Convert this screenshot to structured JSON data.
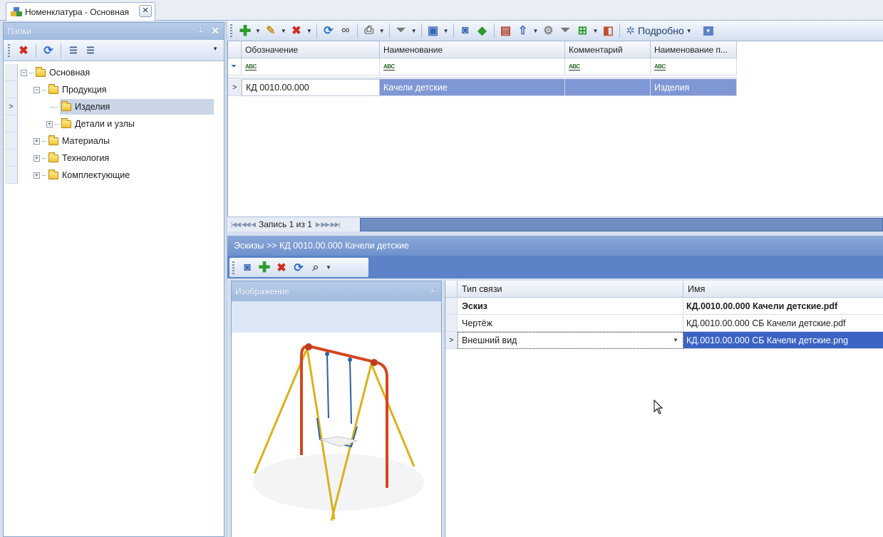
{
  "tab": {
    "title": "Номенклатура - Основная",
    "close": "✕"
  },
  "folders_panel": {
    "title": "Папки",
    "tree": [
      {
        "label": "Основная",
        "level": 0,
        "expander": "−"
      },
      {
        "label": "Продукция",
        "level": 1,
        "expander": "−"
      },
      {
        "label": "Изделия",
        "level": 2,
        "expander": "",
        "selected": true
      },
      {
        "label": "Детали и узлы",
        "level": 2,
        "expander": "+"
      },
      {
        "label": "Материалы",
        "level": 1,
        "expander": "+"
      },
      {
        "label": "Технология",
        "level": 1,
        "expander": "+"
      },
      {
        "label": "Комплектующие",
        "level": 1,
        "expander": "+"
      }
    ]
  },
  "main_toolbar": {
    "detail_label": "Подробно"
  },
  "top_grid": {
    "columns": [
      "Обозначение",
      "Наименование",
      "Комментарий",
      "Наименование п..."
    ],
    "filter_glyph": "ABC",
    "rows": [
      {
        "designation": "КД 0010.00.000",
        "name": "Качели детские",
        "comment": "",
        "group": "Изделия"
      }
    ],
    "navigator": "Запись 1 из 1"
  },
  "breadcrumb": "Эскизы >> КД 0010.00.000 Качели детские",
  "image_panel": {
    "title": "Изображение"
  },
  "links_grid": {
    "columns": [
      "Тип связи",
      "Имя"
    ],
    "rows": [
      {
        "type": "Эскиз",
        "name": "КД.0010.00.000 Качели детские.pdf",
        "bold": true
      },
      {
        "type": "Чертёж",
        "name": "КД.0010.00.000 СБ Качели детские.pdf",
        "bold": false
      },
      {
        "type": "Внешний вид",
        "name": "КД.0010.00.000 СБ Качели детские.png",
        "bold": false,
        "selected": true
      }
    ]
  },
  "colors": {
    "accent": "#6f91cc",
    "selection": "#3b63c4",
    "highlight_row": "#7f97d4"
  }
}
